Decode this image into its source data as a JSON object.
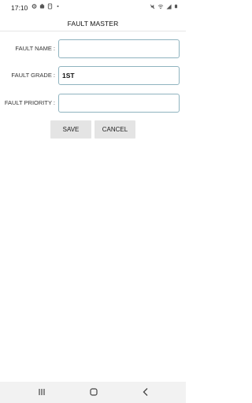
{
  "status_bar": {
    "time": "17:10",
    "left_icons": [
      "settings-icon",
      "notification-icon",
      "files-icon",
      "dot-icon"
    ],
    "right_icons": [
      "mute-icon",
      "wifi-icon",
      "signal-icon",
      "battery-icon"
    ]
  },
  "header": {
    "title": "FAULT MASTER"
  },
  "form": {
    "fault_name": {
      "label": "FAULT NAME :",
      "value": ""
    },
    "fault_grade": {
      "label": "FAULT GRADE :",
      "value": "1ST"
    },
    "fault_priority": {
      "label": "FAULT PRIORITY :",
      "value": ""
    }
  },
  "buttons": {
    "save": "SAVE",
    "cancel": "CANCEL"
  },
  "colors": {
    "input_border": "#8fb3bf",
    "button_bg": "#e4e4e4",
    "nav_bg": "#f2f2f2"
  }
}
